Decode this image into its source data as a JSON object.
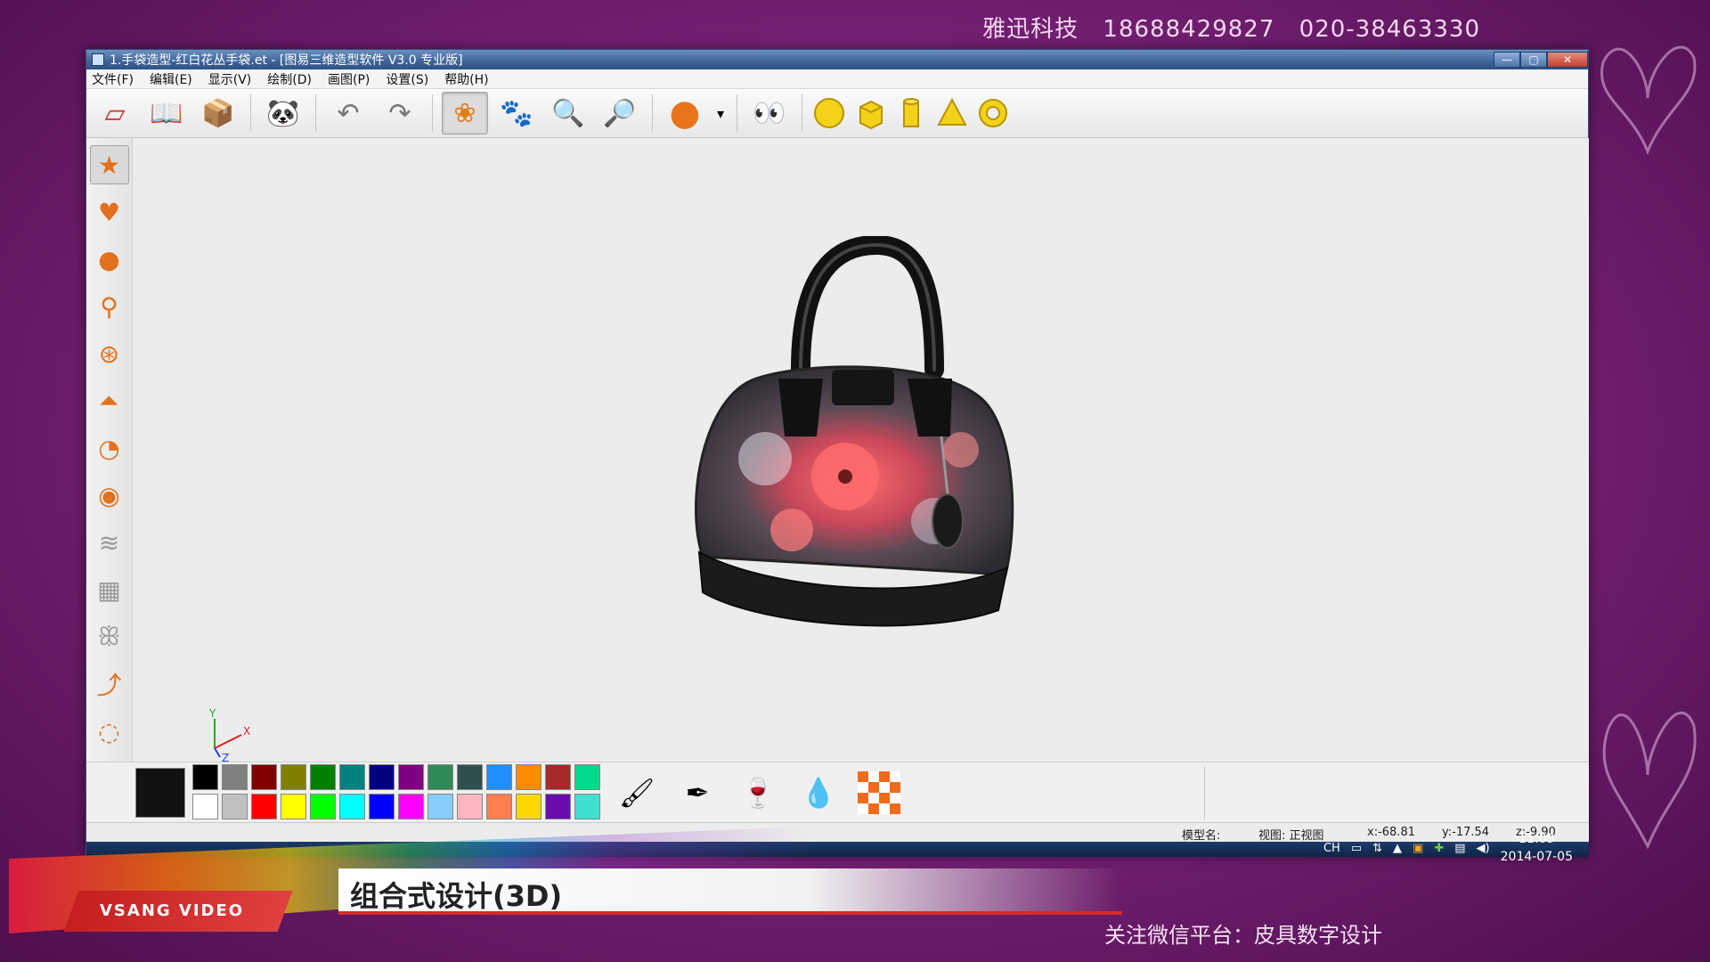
{
  "frame": {
    "contact": "雅迅科技 18688429827 020-38463330",
    "caption": "组合式设计(3D)",
    "brand": "VSANG VIDEO",
    "wechat": "关注微信平台：皮具数字设计"
  },
  "window": {
    "title": "1.手袋造型-红白花丛手袋.et - [图易三维造型软件 V3.0 专业版]",
    "controls": {
      "minimize": "—",
      "maximize": "▢",
      "close": "✕"
    }
  },
  "menu": [
    "文件(F)",
    "编辑(E)",
    "显示(V)",
    "绘制(D)",
    "画图(P)",
    "设置(S)",
    "帮助(H)"
  ],
  "toolbar": {
    "icons": [
      "new-icon",
      "open-icon",
      "save-icon",
      "face-icon",
      "undo-icon",
      "redo-icon",
      "rotate-icon",
      "pan-icon",
      "zoom-in-icon",
      "zoom-out-icon",
      "render-ball-icon",
      "dropdown-icon",
      "view-eyes-icon",
      "sphere-icon",
      "cube-icon",
      "cylinder-icon",
      "cone-icon",
      "torus-icon"
    ],
    "glyphs": [
      "▱",
      "📖",
      "📦",
      "🐼",
      "↶",
      "↷",
      "❀",
      "🐾",
      "🔍",
      "🔎",
      "●",
      "▾",
      "👀"
    ]
  },
  "left_tools": {
    "icons": [
      "star-tool-icon",
      "heart-tool-icon",
      "ball-tool-icon",
      "pin-tool-icon",
      "gourd-tool-icon",
      "bell-tool-icon",
      "pie-tool-icon",
      "disc-tool-icon",
      "wave-tool-icon",
      "grid-tool-icon",
      "butterfly-tool-icon",
      "curve-tool-icon",
      "lasso-tool-icon"
    ],
    "glyphs": [
      "★",
      "♥",
      "●",
      "⚲",
      "⊛",
      "⏶",
      "◔",
      "◉",
      "≋",
      "▦",
      "ꕥ",
      "⤴",
      "◌"
    ]
  },
  "viewport": {
    "axis": {
      "y": "Y",
      "x": "X",
      "z": "Z"
    }
  },
  "palette": {
    "current": "#111111",
    "swatches": [
      "#000000",
      "#808080",
      "#800000",
      "#808000",
      "#008000",
      "#008080",
      "#000080",
      "#800080",
      "#2e8b57",
      "#2f4f4f",
      "#1e90ff",
      "#ff8c00",
      "#a52a2a",
      "#00d98b",
      "#ffffff",
      "#c0c0c0",
      "#ff0000",
      "#ffff00",
      "#00ff00",
      "#00ffff",
      "#0000ff",
      "#ff00ff",
      "#87cefa",
      "#ffb6c1",
      "#ff7f50",
      "#ffd700",
      "#6a0dad",
      "#40e0d0"
    ]
  },
  "paint_tools": {
    "icons": [
      "brush-icon",
      "pen-brush-icon",
      "goblet-icon",
      "drop-icon",
      "checker-icon"
    ],
    "glyphs": [
      "🖌",
      "✒",
      "🍷",
      "💧",
      "▦"
    ]
  },
  "status": {
    "model": "模型名:",
    "view": "视图: 正视图",
    "x": "x:-68.81",
    "y": "y:-17.54",
    "z": "z:-9.90"
  },
  "tray": {
    "lang": "CH",
    "time": "11:09",
    "date": "2014-07-05"
  },
  "colors": {
    "frame_bg": "#7a2378",
    "title_bar": "#3d6399",
    "viewport": "#ececec"
  }
}
